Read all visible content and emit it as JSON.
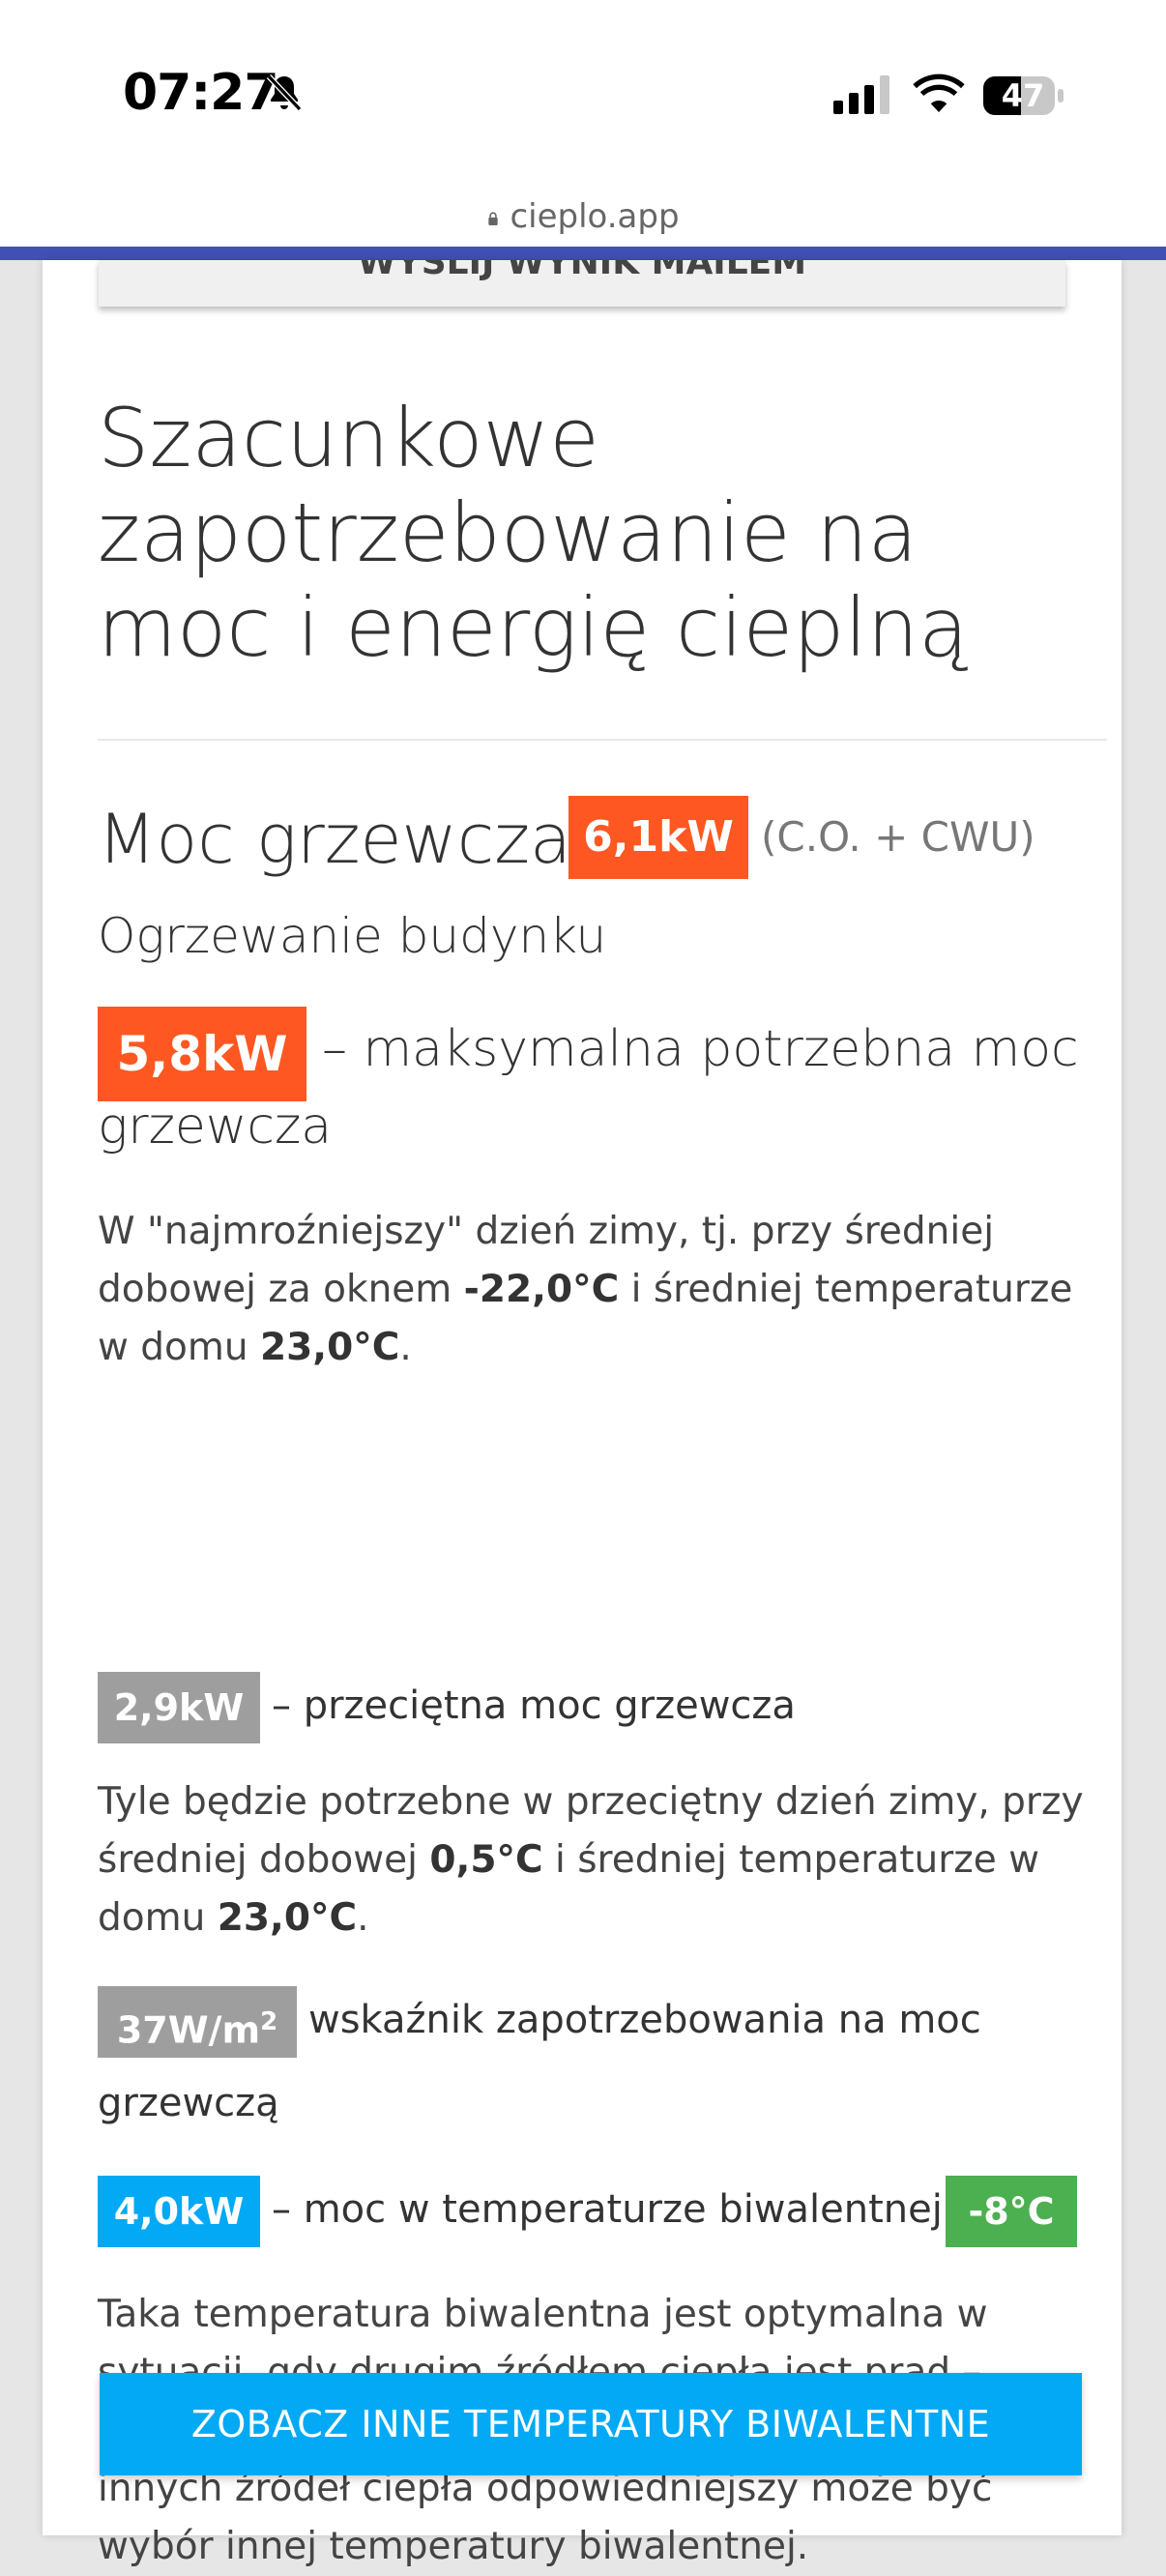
{
  "status_bar": {
    "time": "07:27",
    "battery_level": "47"
  },
  "browser": {
    "url": "cieplo.app"
  },
  "card": {
    "email_button_label": "WYŚLIJ WYNIK MAILEM",
    "title": "Szacunkowe zapotrzebowanie na moc i energię cieplną",
    "heating_power": {
      "label": "Moc grzewcza:",
      "value": "6,1kW",
      "note": "(C.O. + CWU)"
    },
    "section_title": "Ogrzewanie budynku",
    "max_power": {
      "value": "5,8kW",
      "desc_line1": "– maksymalna potrzebna moc",
      "desc_line2": "grzewcza"
    },
    "para1": {
      "t1": "W \"najmroźniejszy\" dzień zimy, tj. przy średniej dobowej za oknem ",
      "b1": "-22,0°C",
      "t2": " i średniej temperaturze w domu ",
      "b2": "23,0°C",
      "t3": "."
    },
    "avg_power": {
      "value": "2,9kW",
      "desc": "– przeciętna moc grzewcza"
    },
    "para2": {
      "t1": "Tyle będzie potrzebne w przeciętny dzień zimy, przy średniej dobowej ",
      "b1": "0,5°C",
      "t2": " i średniej temperaturze w domu ",
      "b2": "23,0°C",
      "t3": "."
    },
    "index": {
      "value": "37W/m",
      "sup": "2",
      "desc_line1": "wskaźnik zapotrzebowania na moc",
      "desc_line2": "grzewczą"
    },
    "bivalent": {
      "value": "4,0kW",
      "desc": "– moc w temperaturze biwalentnej",
      "temp": "-8°C"
    },
    "para3": "Taka temperatura biwalentna jest optymalna w sytuacji, gdy drugim źródłem ciepła jest prąd – grzałki wspomagające pracę pompy ciepła. Dla innych źródeł ciepła odpowiedniejszy może być wybór innej temperatury biwalentnej.",
    "cta_label": "ZOBACZ INNE TEMPERATURY BIWALENTNE"
  },
  "colors": {
    "brand": "#4150b5",
    "orange_badge": "#ff5722",
    "gray_badge": "#9e9e9e",
    "blue_badge": "#03a9f4",
    "green_badge": "#4caf50"
  },
  "icons": [
    "bell-slash-icon",
    "cellular-signal-icon",
    "wifi-icon",
    "battery-icon",
    "lock-icon"
  ]
}
